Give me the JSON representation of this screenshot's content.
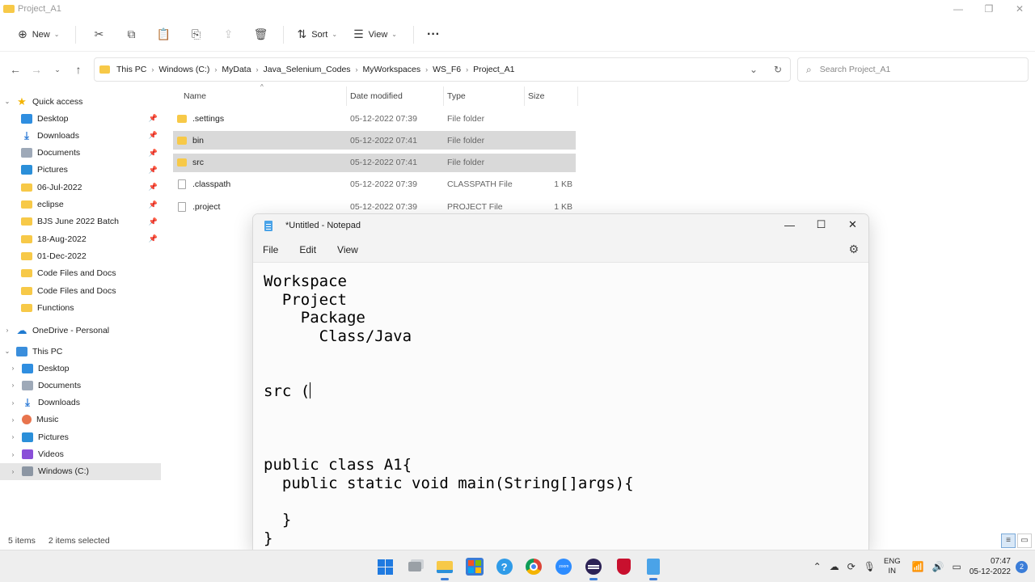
{
  "explorer": {
    "title": "Project_A1",
    "toolbar": {
      "new_label": "New",
      "sort_label": "Sort",
      "view_label": "View",
      "more_label": "···"
    },
    "breadcrumb": [
      "This PC",
      "Windows (C:)",
      "MyData",
      "Java_Selenium_Codes",
      "MyWorkspaces",
      "WS_F6",
      "Project_A1"
    ],
    "search_placeholder": "Search Project_A1",
    "columns": {
      "name": "Name",
      "date": "Date modified",
      "type": "Type",
      "size": "Size"
    },
    "files": [
      {
        "name": ".settings",
        "date": "05-12-2022 07:39",
        "type": "File folder",
        "size": "",
        "icon": "folder-icon",
        "selected": false
      },
      {
        "name": "bin",
        "date": "05-12-2022 07:41",
        "type": "File folder",
        "size": "",
        "icon": "folder-icon",
        "selected": true
      },
      {
        "name": "src",
        "date": "05-12-2022 07:41",
        "type": "File folder",
        "size": "",
        "icon": "folder-icon",
        "selected": true
      },
      {
        "name": ".classpath",
        "date": "05-12-2022 07:39",
        "type": "CLASSPATH File",
        "size": "1 KB",
        "icon": "file-icon",
        "selected": false
      },
      {
        "name": ".project",
        "date": "05-12-2022 07:39",
        "type": "PROJECT File",
        "size": "1 KB",
        "icon": "file-icon",
        "selected": false
      }
    ],
    "nav": {
      "quick_access": "Quick access",
      "quick_items": [
        {
          "label": "Desktop",
          "icon": "desktop-icon",
          "pinned": true
        },
        {
          "label": "Downloads",
          "icon": "download-icon",
          "pinned": true
        },
        {
          "label": "Documents",
          "icon": "documents-icon",
          "pinned": true
        },
        {
          "label": "Pictures",
          "icon": "pictures-icon",
          "pinned": true
        },
        {
          "label": "06-Jul-2022",
          "icon": "folder-icon",
          "pinned": true
        },
        {
          "label": "eclipse",
          "icon": "folder-icon",
          "pinned": true
        },
        {
          "label": "BJS June 2022 Batch",
          "icon": "folder-icon",
          "pinned": true
        },
        {
          "label": "18-Aug-2022",
          "icon": "folder-icon",
          "pinned": true
        },
        {
          "label": "01-Dec-2022",
          "icon": "folder-icon",
          "pinned": false
        },
        {
          "label": "Code Files and Docs",
          "icon": "folder-icon",
          "pinned": false
        },
        {
          "label": "Code Files and Docs",
          "icon": "folder-icon",
          "pinned": false
        },
        {
          "label": "Functions",
          "icon": "folder-icon",
          "pinned": false
        }
      ],
      "onedrive": "OneDrive - Personal",
      "this_pc": "This PC",
      "pc_items": [
        {
          "label": "Desktop",
          "icon": "desktop-icon"
        },
        {
          "label": "Documents",
          "icon": "documents-icon"
        },
        {
          "label": "Downloads",
          "icon": "download-icon"
        },
        {
          "label": "Music",
          "icon": "music-icon"
        },
        {
          "label": "Pictures",
          "icon": "pictures-icon"
        },
        {
          "label": "Videos",
          "icon": "videos-icon"
        },
        {
          "label": "Windows (C:)",
          "icon": "drive-icon"
        }
      ]
    },
    "status": {
      "items": "5 items",
      "selected": "2 items selected"
    }
  },
  "notepad": {
    "title": "*Untitled - Notepad",
    "menu": {
      "file": "File",
      "edit": "Edit",
      "view": "View"
    },
    "lines": [
      "Workspace",
      "  Project",
      "    Package",
      "      Class/Java",
      "",
      "",
      "src (",
      "",
      "",
      "",
      "public class A1{",
      "  public static void main(String[]args){",
      "",
      "  }",
      "}"
    ]
  },
  "taskbar": {
    "lang_top": "ENG",
    "lang_bottom": "IN",
    "time": "07:47",
    "date": "05-12-2022",
    "notification_count": "2",
    "zoom_label": "zoom"
  },
  "colors": {
    "accent": "#1f7ae0",
    "selection": "#d9d9d9",
    "folder": "#f7c948"
  }
}
